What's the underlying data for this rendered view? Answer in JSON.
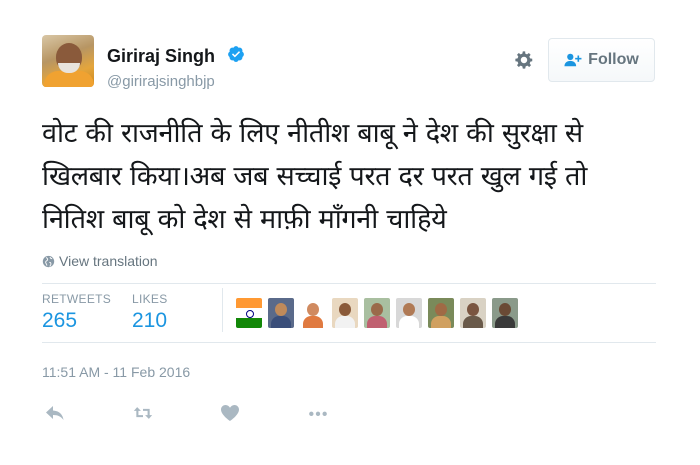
{
  "author": {
    "name": "Giriraj Singh",
    "handle": "@girirajsinghbjp",
    "verified": true
  },
  "follow_button": {
    "label": "Follow",
    "icon": "add-user-icon"
  },
  "settings_icon": "gear-icon",
  "tweet": {
    "lines": [
      "वोट की राजनीति के लिए नीतीश बाबू ने देश की सुरक्षा से",
      "खिलबार किया।अब जब सच्चाई परत दर परत खुल गई तो",
      "नितिश बाबू को देश से माफ़ी माँगनी चाहिये"
    ]
  },
  "translate": {
    "label": "View translation",
    "icon": "globe-icon"
  },
  "stats": {
    "retweets_label": "RETWEETS",
    "retweets": "265",
    "likes_label": "LIKES",
    "likes": "210"
  },
  "timestamp": "11:51 AM - 11 Feb 2016",
  "actions": [
    {
      "name": "reply",
      "icon": "reply-icon"
    },
    {
      "name": "retweet",
      "icon": "retweet-icon"
    },
    {
      "name": "like",
      "icon": "heart-icon"
    },
    {
      "name": "more",
      "icon": "more-icon"
    }
  ],
  "colors": {
    "link_blue": "#1b95e0",
    "muted_gray": "#8899a6",
    "verified_blue": "#1da1f2",
    "action_gray": "#aab8c2"
  }
}
